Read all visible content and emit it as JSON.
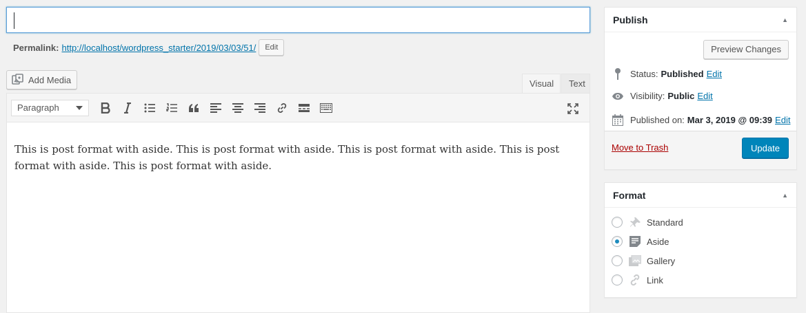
{
  "permalink": {
    "label": "Permalink:",
    "url": "http://localhost/wordpress_starter/2019/03/03/51/",
    "edit_label": "Edit"
  },
  "media": {
    "add_media_label": "Add Media"
  },
  "editor": {
    "tabs": [
      {
        "label": "Visual"
      },
      {
        "label": "Text"
      }
    ],
    "format_select_value": "Paragraph",
    "content": "This is post format with aside. This is post format with aside. This is post format with aside. This is post format with aside. This is post format with aside."
  },
  "publish": {
    "title": "Publish",
    "preview_label": "Preview Changes",
    "status_label": "Status:",
    "status_value": "Published",
    "visibility_label": "Visibility:",
    "visibility_value": "Public",
    "published_label": "Published on:",
    "published_value": "Mar 3, 2019 @ 09:39",
    "edit_label": "Edit",
    "trash_label": "Move to Trash",
    "update_label": "Update"
  },
  "format": {
    "title": "Format",
    "options": [
      {
        "label": "Standard",
        "icon": "pin-icon",
        "selected": false
      },
      {
        "label": "Aside",
        "icon": "aside-icon",
        "selected": true
      },
      {
        "label": "Gallery",
        "icon": "gallery-icon",
        "selected": false
      },
      {
        "label": "Link",
        "icon": "link-icon",
        "selected": false
      }
    ]
  },
  "colors": {
    "primary": "#0085ba",
    "link": "#0073aa",
    "trash": "#aa0000",
    "focus": "#5b9dd9"
  }
}
